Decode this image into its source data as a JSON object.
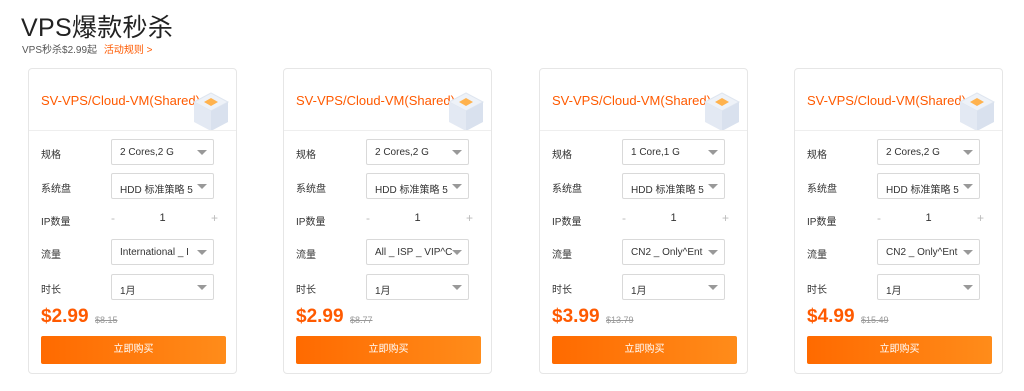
{
  "page": {
    "title": "VPS爆款秒杀",
    "subtitle": "VPS秒杀$2.99起",
    "rules_link": "活动规则 >"
  },
  "labels": {
    "spec": "规格",
    "disk": "系统盘",
    "ip_count": "IP数量",
    "traffic": "流量",
    "duration": "时长",
    "minus": "-",
    "plus": "+",
    "buy": "立即购买"
  },
  "colors": {
    "accent": "#ff5a00",
    "button_start": "#ff6a00",
    "button_end": "#ff8c1a"
  },
  "cards": [
    {
      "title": "SV-VPS/Cloud-VM(Shared)",
      "spec": "2 Cores,2 G",
      "disk": "HDD 标准策略 5",
      "ip_count": "1",
      "traffic": "International _ I",
      "duration": "1月",
      "price": "$2.99",
      "old_price": "$8.15"
    },
    {
      "title": "SV-VPS/Cloud-VM(Shared)",
      "spec": "2 Cores,2 G",
      "disk": "HDD 标准策略 5",
      "ip_count": "1",
      "traffic": "All _ ISP _ VIP^C",
      "duration": "1月",
      "price": "$2.99",
      "old_price": "$8.77"
    },
    {
      "title": "SV-VPS/Cloud-VM(Shared)",
      "spec": "1 Core,1 G",
      "disk": "HDD 标准策略 5",
      "ip_count": "1",
      "traffic": "CN2 _ Only^Ent",
      "duration": "1月",
      "price": "$3.99",
      "old_price": "$13.79"
    },
    {
      "title": "SV-VPS/Cloud-VM(Shared)",
      "spec": "2 Cores,2 G",
      "disk": "HDD 标准策略 5",
      "ip_count": "1",
      "traffic": "CN2 _ Only^Ent",
      "duration": "1月",
      "price": "$4.99",
      "old_price": "$15.49"
    }
  ]
}
